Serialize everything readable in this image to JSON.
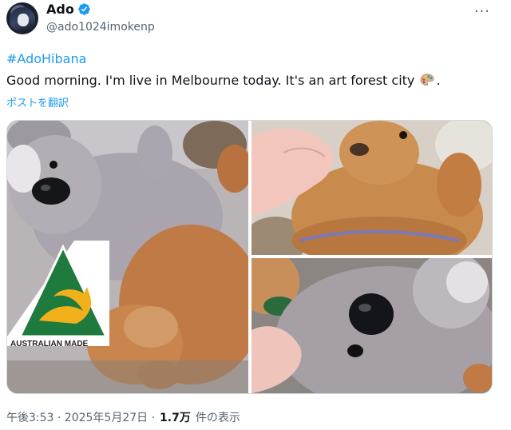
{
  "author": {
    "display_name": "Ado",
    "handle": "@ado1024imokenp",
    "avatar_icon": "avatar-image",
    "verified_icon": "verified-badge-icon"
  },
  "menu": {
    "more_label": "···"
  },
  "post": {
    "hashtag": "#AdoHibana",
    "text_before_emoji": "Good morning. I'm live in Melbourne today. It's an art forest city",
    "emoji_icon": "artist-palette-icon",
    "text_after_emoji": ".",
    "translate_link": "ポストを翻訳"
  },
  "media": {
    "images": [
      {
        "icon": "photo-koala-kangaroo-plush",
        "sign_text": "AUSTRALIAN MADE"
      },
      {
        "icon": "photo-kangaroo-plush"
      },
      {
        "icon": "photo-koala-plush-closeup"
      }
    ]
  },
  "meta": {
    "timestamp": "午後3:53 · 2025年5月27日 · ",
    "views_count": "1.7万",
    "views_label": "件の表示"
  },
  "colors": {
    "link": "#1d9bf0",
    "text": "#0f1419",
    "secondary": "#536471",
    "australian_made_green": "#1f7a3e",
    "australian_made_gold": "#f2b11a"
  }
}
